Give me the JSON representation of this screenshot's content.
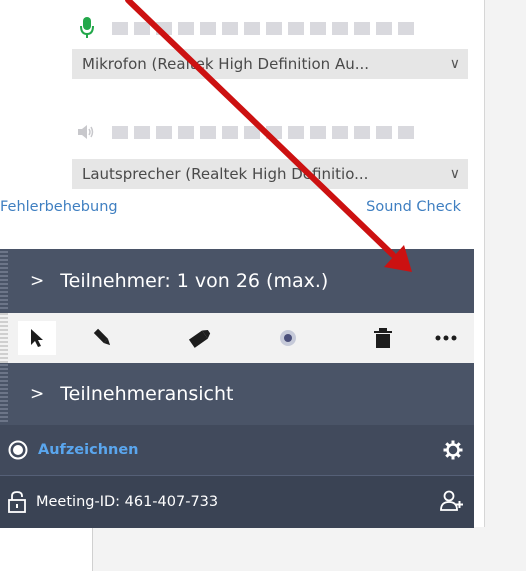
{
  "audio": {
    "microphone_select": "Mikrofon (Realtek High Definition Au...",
    "speaker_select": "Lautsprecher (Realtek High Definitio...",
    "troubleshoot_link": "Fehlerbehebung",
    "sound_check_link": "Sound Check"
  },
  "participants": {
    "header": "Teilnehmer: 1 von 26 (max.)"
  },
  "toolbar": {
    "icons": [
      "pointer-icon",
      "pen-icon",
      "highlighter-icon",
      "laser-pointer-icon",
      "trash-icon",
      "more-icon"
    ]
  },
  "participant_view": {
    "header": "Teilnehmeransicht"
  },
  "record": {
    "label": "Aufzeichnen"
  },
  "meeting": {
    "id_label": "Meeting-ID: 461-407-733"
  },
  "colors": {
    "dark_header": "#4a5467",
    "record_bar": "#414a5c",
    "link_blue": "#3f7fc1",
    "record_text": "#5aa6ee",
    "mic_green": "#22a84a",
    "annotation_arrow": "#cc1111"
  }
}
